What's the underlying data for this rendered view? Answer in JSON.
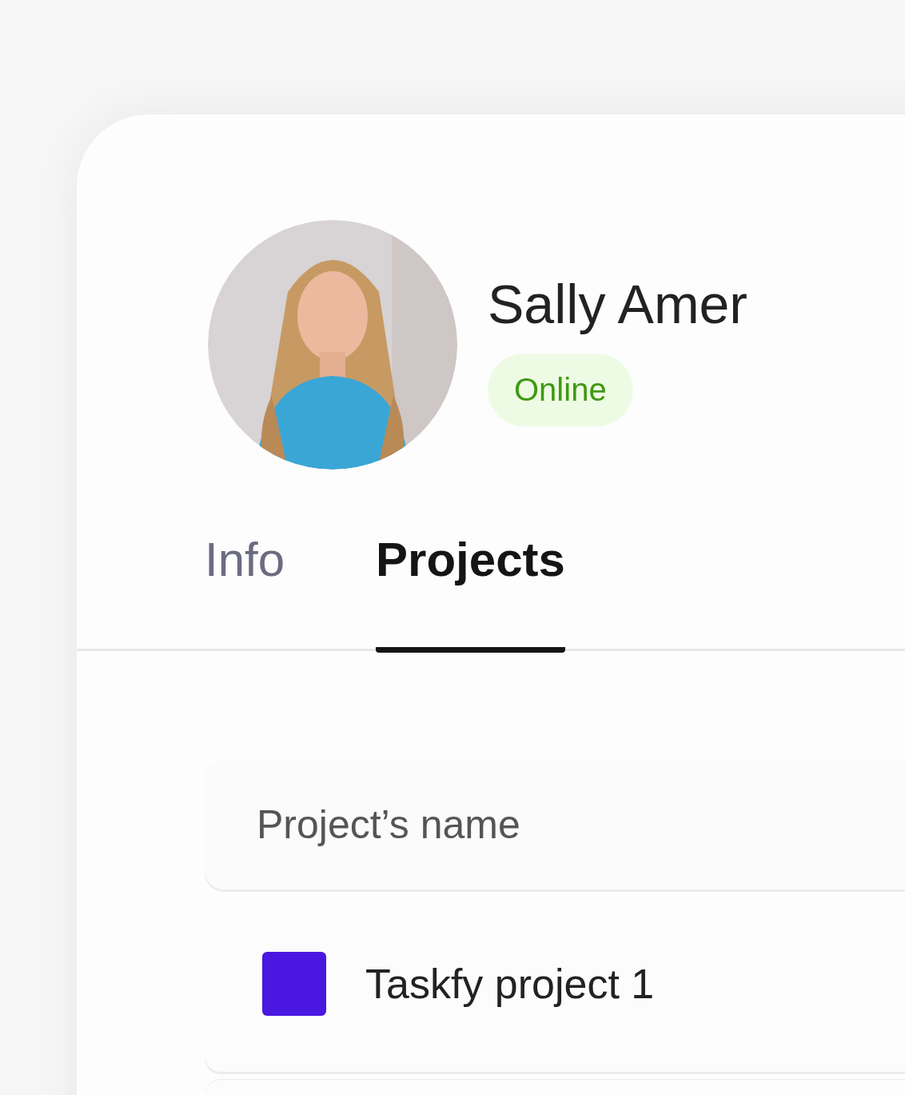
{
  "profile": {
    "name": "Sally Amer",
    "status": {
      "label": "Online",
      "kind": "online"
    }
  },
  "tabs": [
    {
      "label": "Info",
      "selected": false
    },
    {
      "label": "Projects",
      "selected": true
    }
  ],
  "table": {
    "columns": [
      "Project’s name"
    ],
    "rows": [
      {
        "name": "Taskfy project 1",
        "color": "#4a17e0"
      }
    ]
  }
}
